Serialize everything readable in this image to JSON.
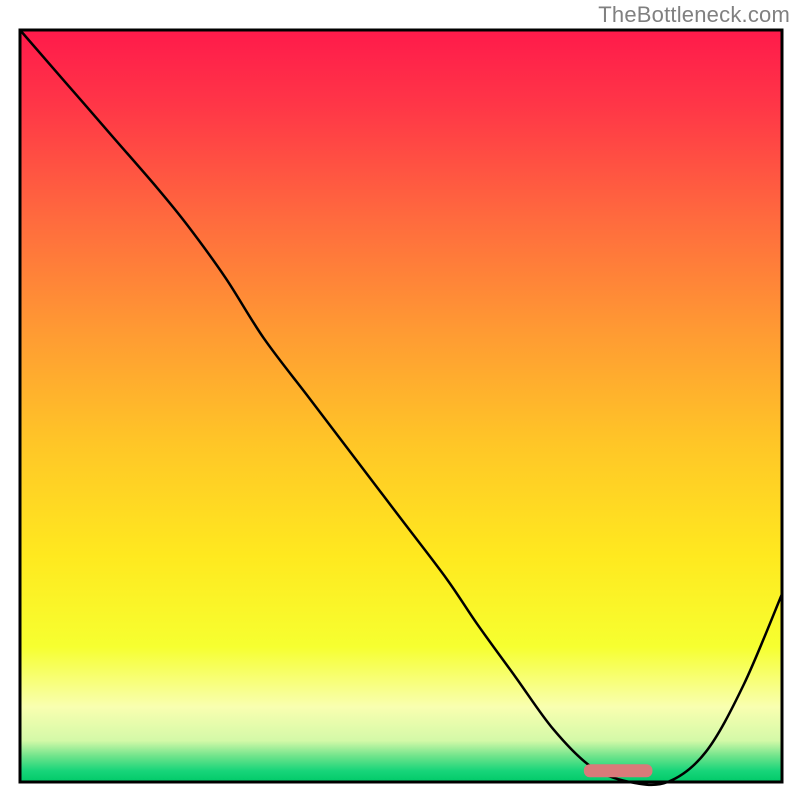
{
  "watermark": "TheBottleneck.com",
  "chart_data": {
    "type": "line",
    "title": "",
    "xlabel": "",
    "ylabel": "",
    "xlim": [
      0,
      100
    ],
    "ylim": [
      0,
      100
    ],
    "grid": false,
    "series": [
      {
        "name": "bottleneck-curve",
        "x": [
          0,
          6,
          12,
          18,
          22,
          27,
          32,
          38,
          44,
          50,
          56,
          60,
          65,
          70,
          75,
          80,
          85,
          90,
          95,
          100
        ],
        "y": [
          100,
          93,
          86,
          79,
          74,
          67,
          59,
          51,
          43,
          35,
          27,
          21,
          14,
          7,
          2,
          0,
          0,
          4,
          13,
          25
        ]
      }
    ],
    "marker": {
      "name": "optimal-range",
      "x_start": 74,
      "x_end": 83,
      "y": 1.5,
      "color": "#d97a7a"
    },
    "gradient_stops": [
      {
        "offset": 0.0,
        "color": "#ff1a4b"
      },
      {
        "offset": 0.1,
        "color": "#ff3647"
      },
      {
        "offset": 0.25,
        "color": "#ff6a3e"
      },
      {
        "offset": 0.4,
        "color": "#ff9a33"
      },
      {
        "offset": 0.55,
        "color": "#ffc627"
      },
      {
        "offset": 0.7,
        "color": "#ffe91f"
      },
      {
        "offset": 0.82,
        "color": "#f6ff30"
      },
      {
        "offset": 0.9,
        "color": "#f9ffb0"
      },
      {
        "offset": 0.945,
        "color": "#d4f9a8"
      },
      {
        "offset": 0.965,
        "color": "#72e48c"
      },
      {
        "offset": 0.985,
        "color": "#18d57a"
      },
      {
        "offset": 1.0,
        "color": "#00c968"
      }
    ]
  }
}
